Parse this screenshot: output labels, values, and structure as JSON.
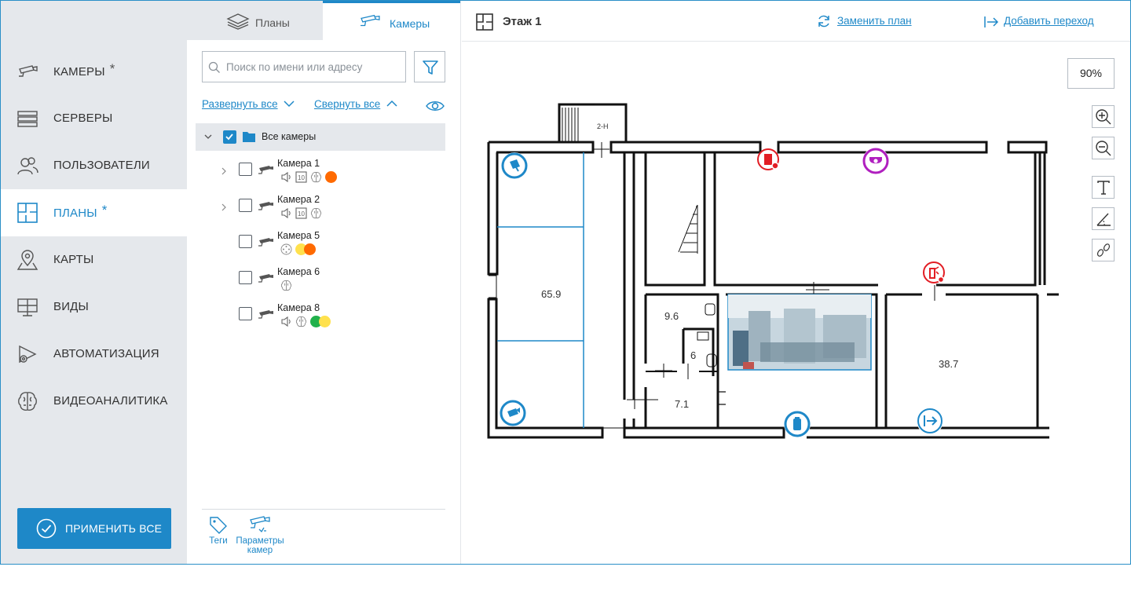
{
  "nav": {
    "items": [
      {
        "label": "КАМЕРЫ",
        "star": "*",
        "icon": "camera-icon"
      },
      {
        "label": "СЕРВЕРЫ",
        "star": "",
        "icon": "server-icon"
      },
      {
        "label": "ПОЛЬЗОВАТЕЛИ",
        "star": "",
        "icon": "users-icon"
      },
      {
        "label": "ПЛАНЫ",
        "star": "*",
        "icon": "plans-icon",
        "active": true
      },
      {
        "label": "КАРТЫ",
        "star": "",
        "icon": "map-pin-icon"
      },
      {
        "label": "ВИДЫ",
        "star": "",
        "icon": "views-icon"
      },
      {
        "label": "АВТОМАТИЗАЦИЯ",
        "star": "",
        "icon": "automation-icon"
      },
      {
        "label": "ВИДЕОАНАЛИТИКА",
        "star": "",
        "icon": "brain-icon"
      }
    ],
    "apply_all": "ПРИМЕНИТЬ ВСЕ"
  },
  "panel": {
    "tabs": {
      "plans": "Планы",
      "cameras": "Камеры"
    },
    "search_placeholder": "Поиск по имени или адресу",
    "expand_all": "Развернуть все",
    "collapse_all": "Свернуть все",
    "root": "Все камеры",
    "cameras": [
      {
        "name": "Камера 1",
        "expandable": true,
        "icons": [
          "sound-icon",
          "archive-icon",
          "brain-icon"
        ],
        "dots": [
          "#ff6a00"
        ]
      },
      {
        "name": "Камера 2",
        "expandable": true,
        "icons": [
          "sound-icon",
          "archive-icon",
          "brain-icon"
        ],
        "dots": []
      },
      {
        "name": "Камера 5",
        "expandable": false,
        "icons": [
          "ptz-icon"
        ],
        "dots": [
          "#ffe14d",
          "#ff6a00"
        ]
      },
      {
        "name": "Камера 6",
        "expandable": false,
        "icons": [
          "brain-icon"
        ],
        "dots": []
      },
      {
        "name": "Камера 8",
        "expandable": false,
        "icons": [
          "sound-icon",
          "brain-icon"
        ],
        "dots": [
          "#22b14c",
          "#ffe14d"
        ]
      }
    ],
    "bottom": {
      "tags": "Теги",
      "cam_params": "Параметры камер"
    }
  },
  "main": {
    "title": "Этаж 1",
    "replace_plan": "Заменить план",
    "add_transition": "Добавить переход",
    "zoom": "90%",
    "rooms": [
      "65.9",
      "9.6",
      "6",
      "7.1",
      "38.7"
    ],
    "stair_label": "2-Н",
    "accent": "#1e88c8"
  }
}
